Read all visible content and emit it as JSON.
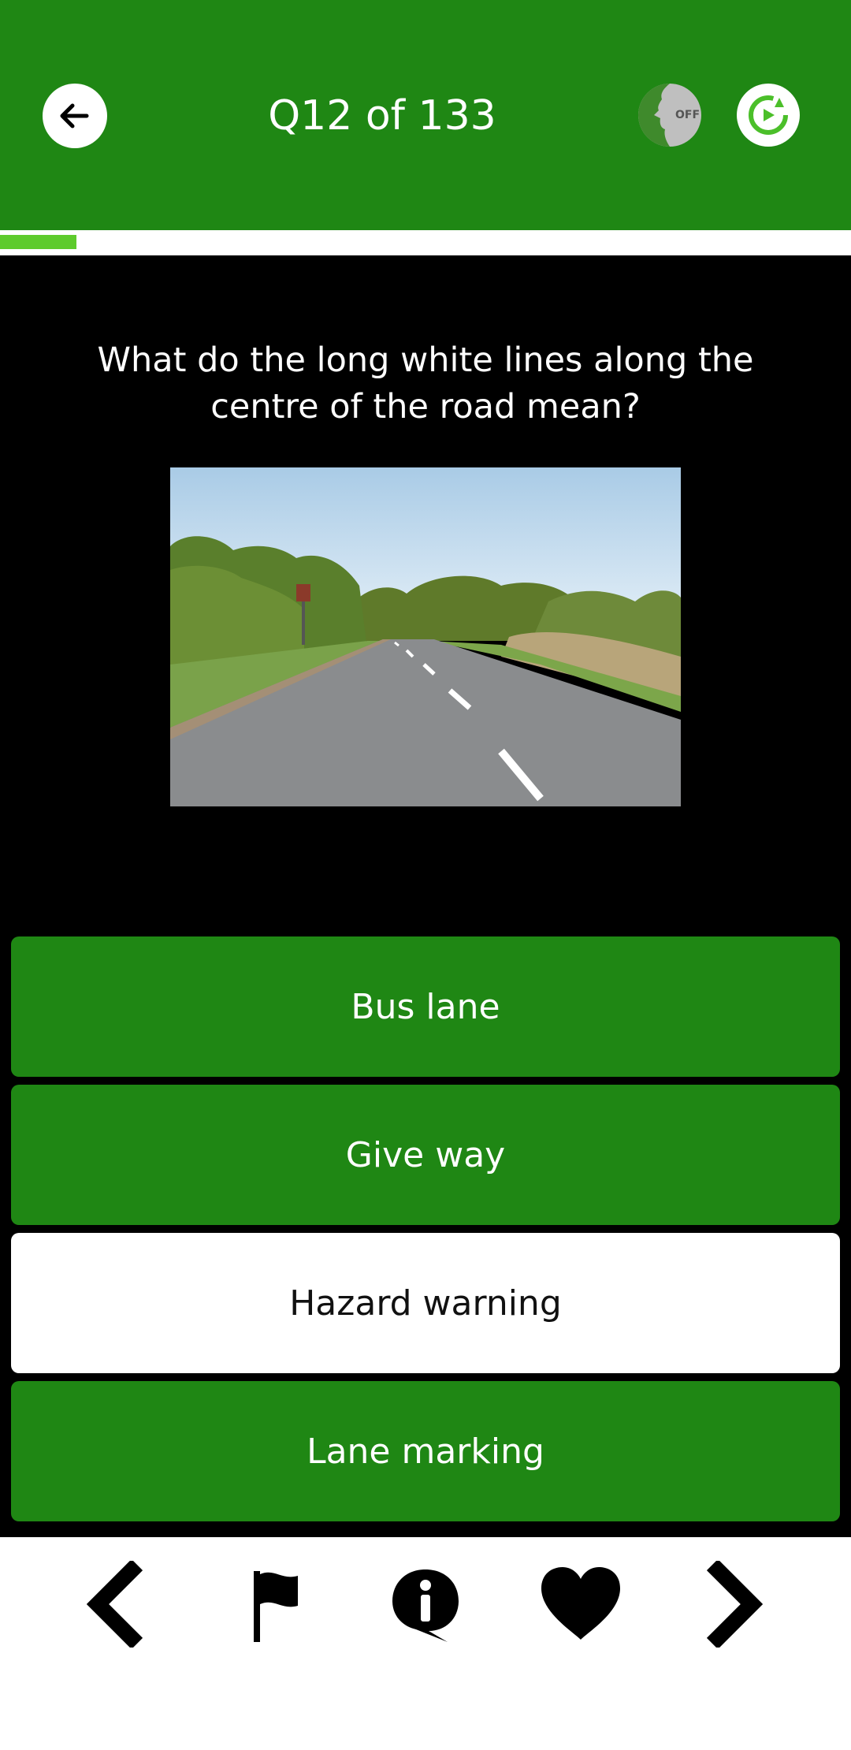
{
  "header": {
    "title": "Q12 of 133",
    "back_icon": "arrow-left-icon",
    "voice_toggle_label": "OFF",
    "reset_icon": "refresh-icon",
    "background": "#1f8714"
  },
  "progress": {
    "fraction": 0.0902,
    "color": "#5dcb2c"
  },
  "question": {
    "text": "What do the long white lines along the centre of the road mean?"
  },
  "answers": [
    {
      "label": "Bus lane",
      "selected": false
    },
    {
      "label": "Give way",
      "selected": false
    },
    {
      "label": "Hazard warning",
      "selected": true
    },
    {
      "label": "Lane marking",
      "selected": false
    }
  ],
  "footer": {
    "icons": [
      "chevron-left-icon",
      "flag-icon",
      "info-bubble-icon",
      "heart-icon",
      "chevron-right-icon"
    ]
  }
}
